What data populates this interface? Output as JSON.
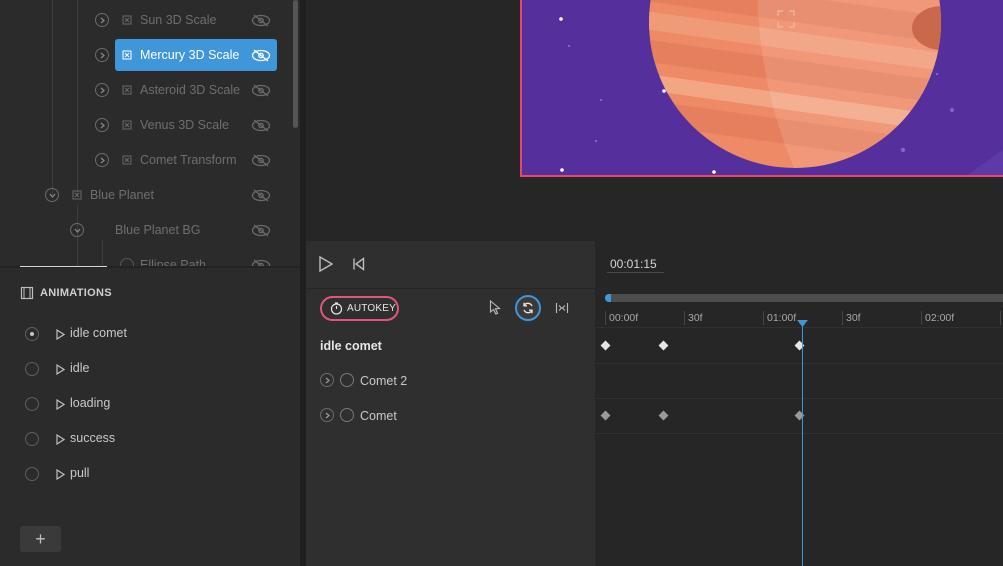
{
  "hierarchy": {
    "items": [
      {
        "label": "Sun 3D Scale",
        "selected": false
      },
      {
        "label": "Mercury 3D Scale",
        "selected": true
      },
      {
        "label": "Asteroid 3D Scale",
        "selected": false
      },
      {
        "label": "Venus 3D Scale",
        "selected": false
      },
      {
        "label": "Comet Transform",
        "selected": false
      },
      {
        "label": "Blue Planet",
        "selected": false
      },
      {
        "label": "Blue Planet BG",
        "selected": false
      },
      {
        "label": "Ellipse Path",
        "selected": false
      }
    ]
  },
  "animations_panel": {
    "title": "ANIMATIONS",
    "items": [
      {
        "label": "idle comet",
        "active": true
      },
      {
        "label": "idle",
        "active": false
      },
      {
        "label": "loading",
        "active": false
      },
      {
        "label": "success",
        "active": false
      },
      {
        "label": "pull",
        "active": false
      }
    ],
    "add_label": "+"
  },
  "timeline": {
    "current_time": "00:01:15",
    "autokey_label": "AUTOKEY",
    "animation_name": "idle comet",
    "tracks": [
      "Comet 2",
      "Comet"
    ],
    "ticks": [
      "00:00f",
      "30f",
      "01:00f",
      "30f",
      "02:00f"
    ]
  },
  "colors": {
    "accent_blue": "#3f96d8",
    "autokey_red": "#e0567a",
    "artboard_bg": "#55309c",
    "planet": "#ee8a66"
  }
}
